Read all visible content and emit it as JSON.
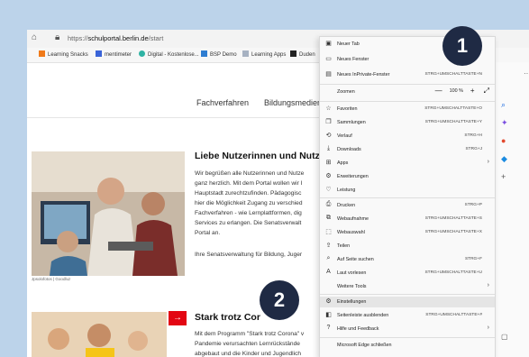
{
  "browser": {
    "url_prefix": "https://",
    "url_domain": "schulportal.berlin.de",
    "url_path": "/start",
    "bookmarks": [
      {
        "label": "Learning Snacks",
        "color": "#f07a1a"
      },
      {
        "label": "mentimeter",
        "color": "#3a64d8"
      },
      {
        "label": "Digital - Kostenlose...",
        "color": "#2fb3a4"
      },
      {
        "label": "BSP Demo",
        "color": "#2e7dd1"
      },
      {
        "label": "Learning Apps",
        "color": "#a7b2c2"
      },
      {
        "label": "Duden",
        "color": "#222222"
      }
    ]
  },
  "site": {
    "nav": [
      "Fachverfahren",
      "Bildungsmedien"
    ],
    "photo_caption": "Jpsolofotos | Goodluz",
    "heading1": "Liebe Nutzerinnen und Nutz",
    "para1": [
      "Wir begrüßen alle Nutzerinnen und Nutze",
      "ganz herzlich. Mit dem Portal wollen wir I",
      "Hauptstadt zurechtzufinden. Pädagogisc",
      "hier die Möglichkeit Zugang zu verschied",
      "Fachverfahren - wie Lernplattformen, dig",
      "Services zu erlangen. Die Senatsverwalt",
      "Portal an."
    ],
    "para1_signoff": "Ihre Senatsverwaltung für Bildung, Juger",
    "heading2": "Stark trotz Cor",
    "para2": [
      "Mit dem Programm \"Stark trotz Corona\" v",
      "Pandemie verursachten Lernrückstände",
      "abgebaut und die Kinder und Jugendlich"
    ],
    "arrow": "→"
  },
  "menu": {
    "items": [
      {
        "icon": "▣",
        "label": "Neuer Tab",
        "shortcut": "",
        "arrow": ""
      },
      {
        "icon": "▭",
        "label": "Neues Fenster",
        "shortcut": "",
        "arrow": ""
      },
      {
        "icon": "▤",
        "label": "Neues InPrivate-Fenster",
        "shortcut": "STRG+UMSCHALTTASTE+N",
        "arrow": ""
      },
      {
        "icon": "☆",
        "label": "Favoriten",
        "shortcut": "STRG+UMSCHALTTASTE+O",
        "arrow": ""
      },
      {
        "icon": "❒",
        "label": "Sammlungen",
        "shortcut": "STRG+UMSCHALTTASTE+Y",
        "arrow": ""
      },
      {
        "icon": "⟲",
        "label": "Verlauf",
        "shortcut": "STRG+H",
        "arrow": ""
      },
      {
        "icon": "⤓",
        "label": "Downloads",
        "shortcut": "STRG+J",
        "arrow": ""
      },
      {
        "icon": "⊞",
        "label": "Apps",
        "shortcut": "",
        "arrow": "›"
      },
      {
        "icon": "⚙",
        "label": "Erweiterungen",
        "shortcut": "",
        "arrow": ""
      },
      {
        "icon": "♡",
        "label": "Leistung",
        "shortcut": "",
        "arrow": ""
      },
      {
        "icon": "⎙",
        "label": "Drucken",
        "shortcut": "STRG+P",
        "arrow": ""
      },
      {
        "icon": "⧉",
        "label": "Webaufnahme",
        "shortcut": "STRG+UMSCHALTTASTE+S",
        "arrow": ""
      },
      {
        "icon": "⬚",
        "label": "Webauswahl",
        "shortcut": "STRG+UMSCHALTTASTE+X",
        "arrow": ""
      },
      {
        "icon": "⇪",
        "label": "Teilen",
        "shortcut": "",
        "arrow": ""
      },
      {
        "icon": "⌕",
        "label": "Auf Seite suchen",
        "shortcut": "STRG+F",
        "arrow": ""
      },
      {
        "icon": "A",
        "label": "Laut vorlesen",
        "shortcut": "STRG+UMSCHALTTASTE+U",
        "arrow": ""
      },
      {
        "icon": "",
        "label": "Weitere Tools",
        "shortcut": "",
        "arrow": "›"
      },
      {
        "icon": "⚙",
        "label": "Einstellungen",
        "shortcut": "",
        "arrow": ""
      },
      {
        "icon": "◧",
        "label": "Seitenleiste ausblenden",
        "shortcut": "STRG+UMSCHALTTASTE+#",
        "arrow": ""
      },
      {
        "icon": "?",
        "label": "Hilfe und Feedback",
        "shortcut": "",
        "arrow": "›"
      },
      {
        "icon": "",
        "label": "Microsoft Edge schließen",
        "shortcut": "",
        "arrow": ""
      }
    ],
    "zoom_label": "Zoomen",
    "zoom_minus": "—",
    "zoom_value": "100 %",
    "zoom_plus": "+",
    "zoom_full": "⤢"
  },
  "callouts": {
    "one": "1",
    "two": "2"
  }
}
